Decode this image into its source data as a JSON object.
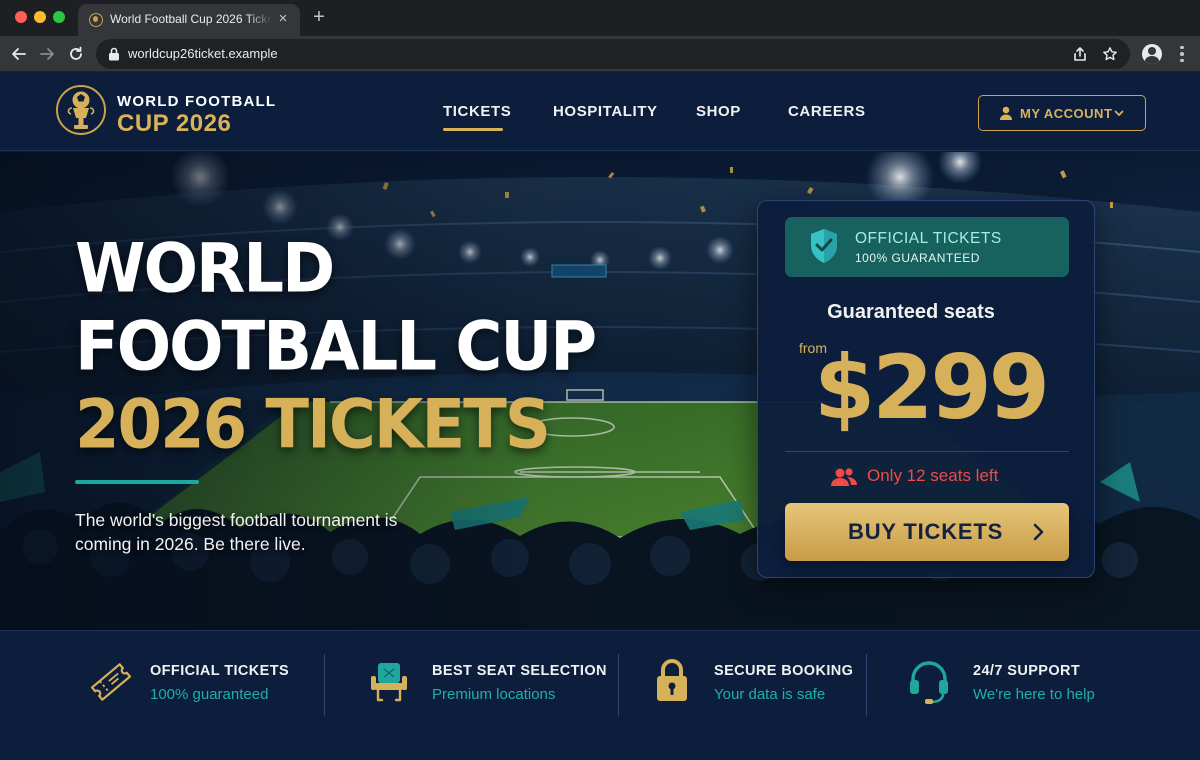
{
  "browser": {
    "tab_title": "World Football Cup 2026 Tickets",
    "url": "worldcup26ticket.example"
  },
  "header": {
    "brand_line1": "WORLD FOOTBALL",
    "brand_line2": "CUP 2026",
    "nav": [
      {
        "label": "TICKETS",
        "active": true
      },
      {
        "label": "HOSPITALITY",
        "active": false
      },
      {
        "label": "SHOP",
        "active": false
      },
      {
        "label": "CAREERS",
        "active": false
      }
    ],
    "account_label": "MY ACCOUNT"
  },
  "hero": {
    "title_line1": "WORLD",
    "title_line2": "FOOTBALL CUP",
    "title_line3": "2026 TICKETS",
    "subtitle": "The world's biggest football tournament is coming in 2026. Be there live."
  },
  "ticket_card": {
    "official_title": "OFFICIAL TICKETS",
    "official_sub": "100% GUARANTEED",
    "headline": "Guaranteed seats",
    "from_label": "from",
    "price": "$299",
    "seats_left": "Only 12 seats left",
    "buy_label": "BUY TICKETS"
  },
  "features": [
    {
      "title": "OFFICIAL TICKETS",
      "subtitle": "100% guaranteed",
      "icon": "ticket-icon"
    },
    {
      "title": "BEST SEAT SELECTION",
      "subtitle": "Premium locations",
      "icon": "seat-icon"
    },
    {
      "title": "SECURE BOOKING",
      "subtitle": "Your data is safe",
      "icon": "padlock-icon"
    },
    {
      "title": "24/7 SUPPORT",
      "subtitle": "We're here to help",
      "icon": "headset-icon"
    }
  ],
  "colors": {
    "navy": "#0c1e3c",
    "gold": "#d7b05a",
    "teal": "#1fb0a6",
    "alert_red": "#ef4a4a"
  }
}
